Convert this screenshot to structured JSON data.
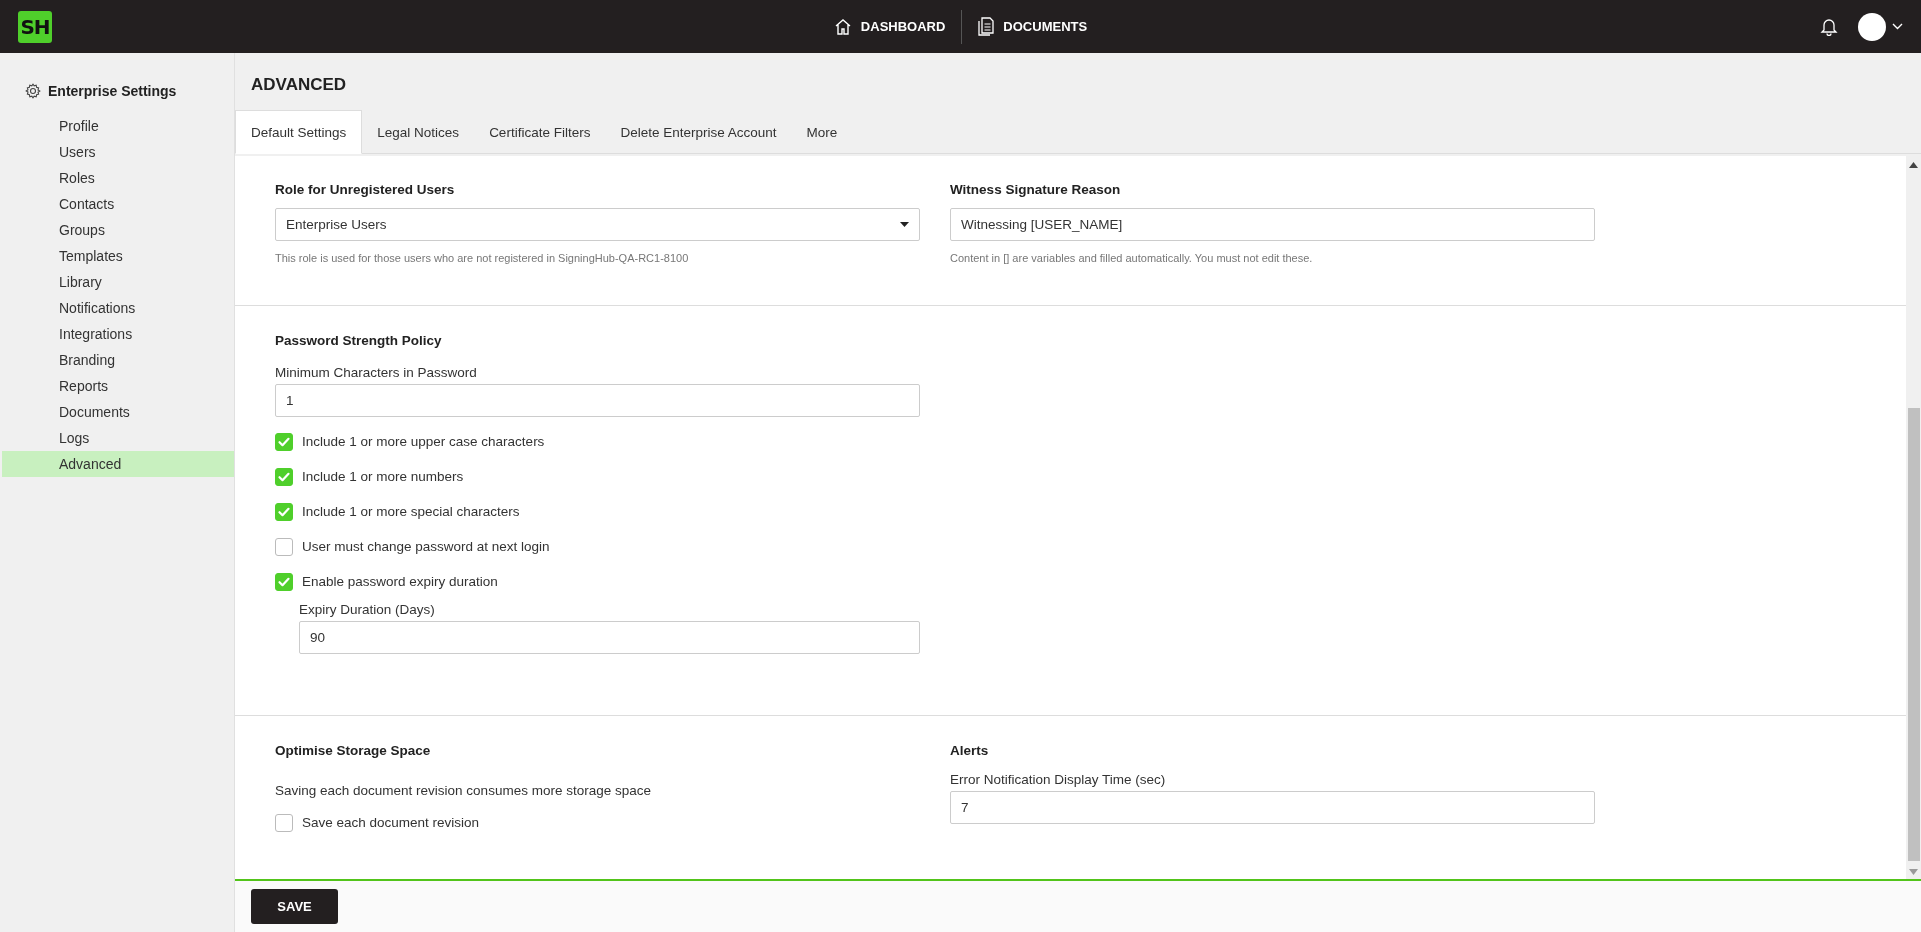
{
  "topbar": {
    "logo": "SH",
    "nav": [
      {
        "label": "DASHBOARD"
      },
      {
        "label": "DOCUMENTS"
      }
    ]
  },
  "sidebar": {
    "title": "Enterprise Settings",
    "items": [
      {
        "label": "Profile",
        "selected": false
      },
      {
        "label": "Users",
        "selected": false
      },
      {
        "label": "Roles",
        "selected": false
      },
      {
        "label": "Contacts",
        "selected": false
      },
      {
        "label": "Groups",
        "selected": false
      },
      {
        "label": "Templates",
        "selected": false
      },
      {
        "label": "Library",
        "selected": false
      },
      {
        "label": "Notifications",
        "selected": false
      },
      {
        "label": "Integrations",
        "selected": false
      },
      {
        "label": "Branding",
        "selected": false
      },
      {
        "label": "Reports",
        "selected": false
      },
      {
        "label": "Documents",
        "selected": false
      },
      {
        "label": "Logs",
        "selected": false
      },
      {
        "label": "Advanced",
        "selected": true
      }
    ]
  },
  "page_title": "ADVANCED",
  "tabs": [
    {
      "label": "Default Settings",
      "selected": true
    },
    {
      "label": "Legal Notices",
      "selected": false
    },
    {
      "label": "Certificate Filters",
      "selected": false
    },
    {
      "label": "Delete Enterprise Account",
      "selected": false
    },
    {
      "label": "More",
      "selected": false
    }
  ],
  "role_section": {
    "heading": "Role for Unregistered Users",
    "value": "Enterprise Users",
    "hint": "This role is used for those users who are not registered in SigningHub-QA-RC1-8100"
  },
  "witness_section": {
    "heading": "Witness Signature Reason",
    "value": "Witnessing [USER_NAME]",
    "hint": "Content in [] are variables and filled automatically. You must not edit these."
  },
  "password_policy": {
    "heading": "Password Strength Policy",
    "min_label": "Minimum Characters in Password",
    "min_value": "1",
    "options": [
      {
        "label": "Include 1 or more upper case characters",
        "checked": true
      },
      {
        "label": "Include 1 or more numbers",
        "checked": true
      },
      {
        "label": "Include 1 or more special characters",
        "checked": true
      },
      {
        "label": "User must change password at next login",
        "checked": false
      },
      {
        "label": "Enable password expiry duration",
        "checked": true
      }
    ],
    "expiry_label": "Expiry Duration (Days)",
    "expiry_value": "90"
  },
  "storage": {
    "heading": "Optimise Storage Space",
    "description": "Saving each document revision consumes more storage space",
    "option": {
      "label": "Save each document revision",
      "checked": false
    }
  },
  "alerts": {
    "heading": "Alerts",
    "label": "Error Notification Display Time (sec)",
    "value": "7"
  },
  "save_button": "SAVE"
}
